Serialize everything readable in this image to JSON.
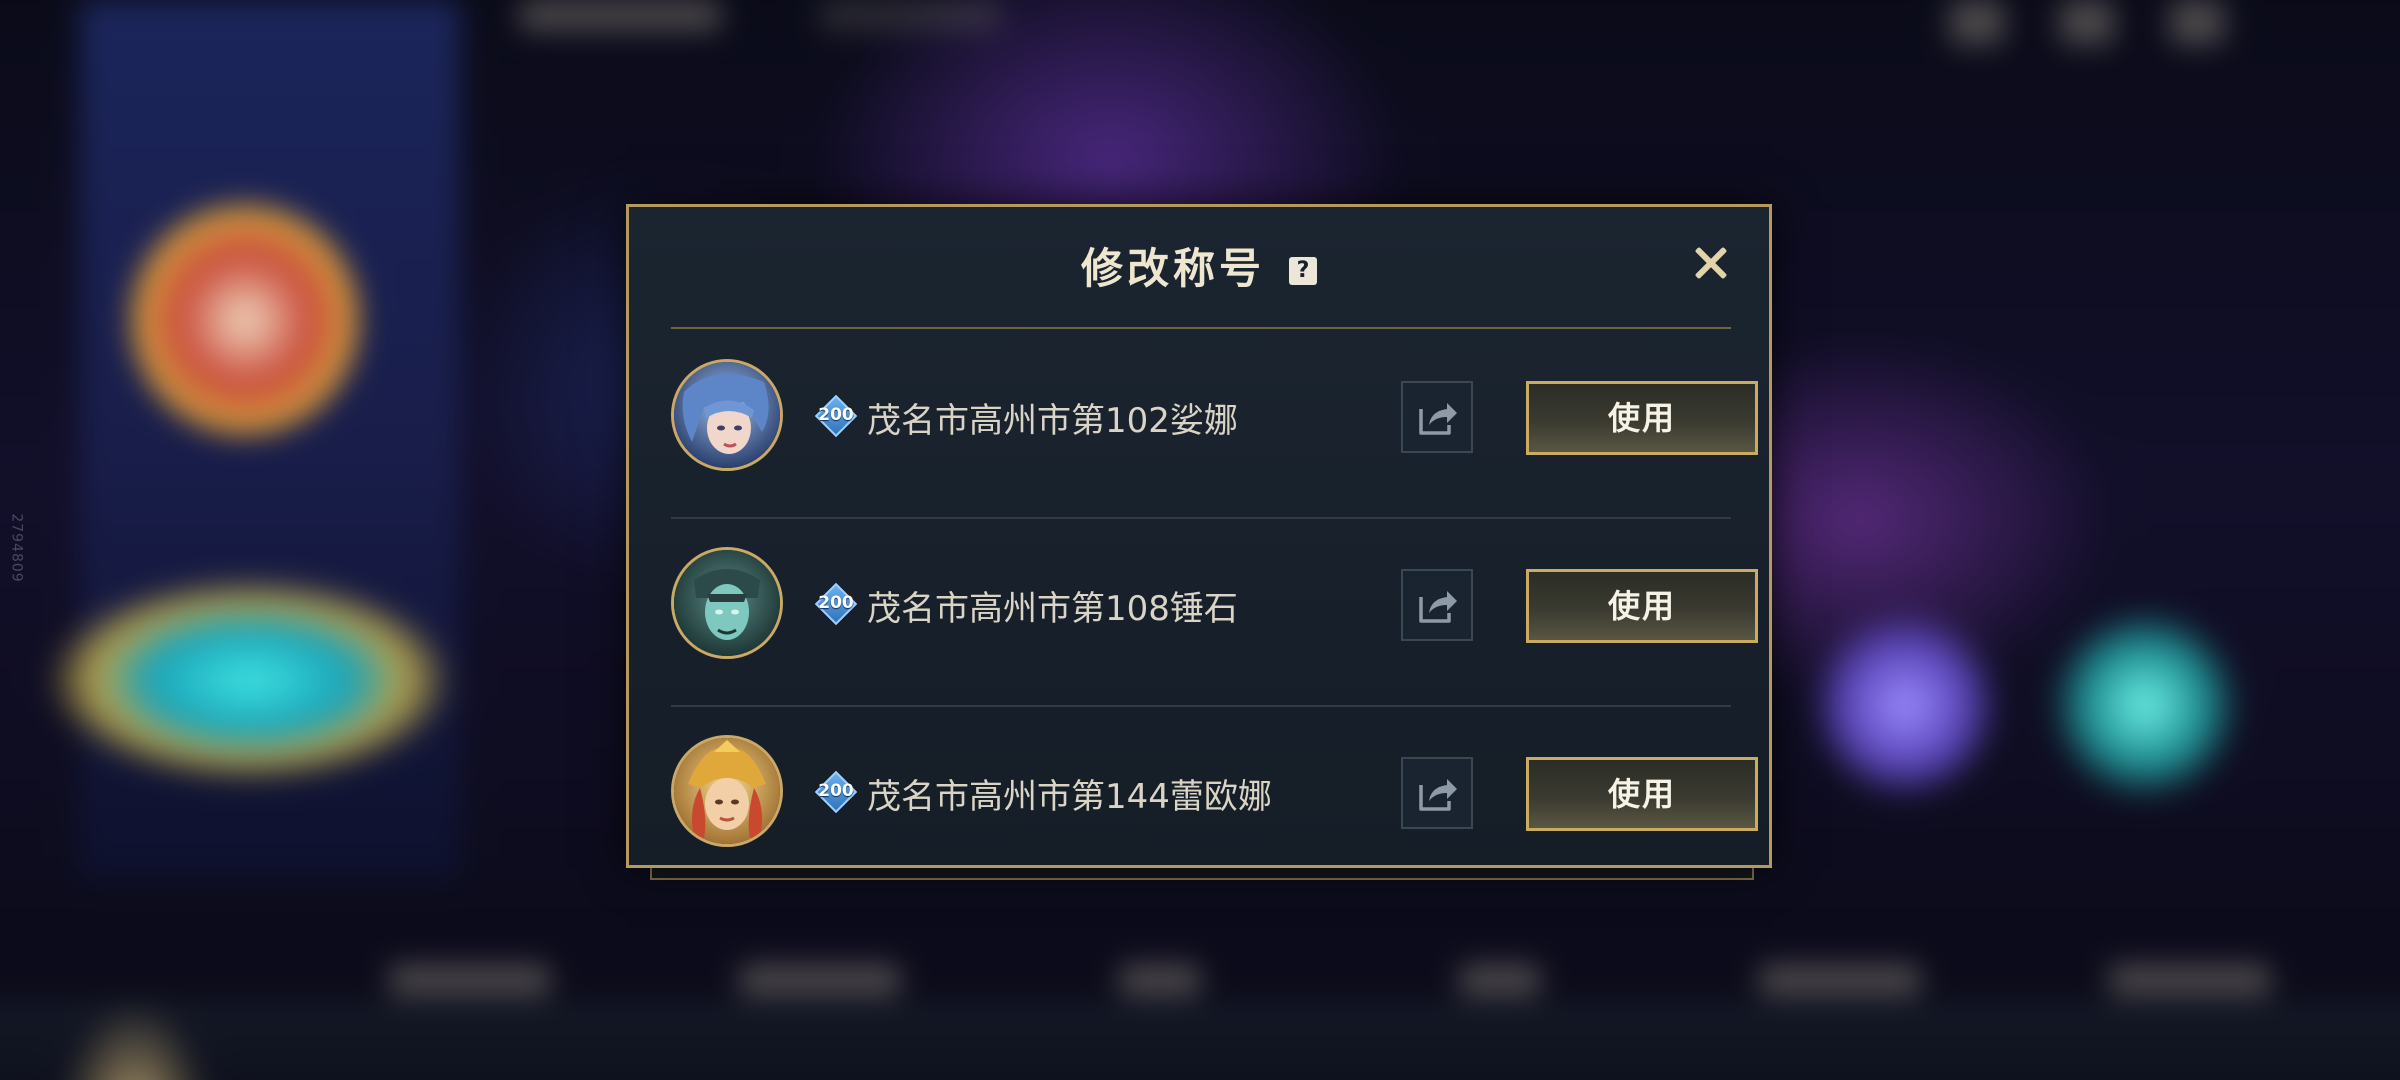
{
  "side_id": "2794809",
  "dialog": {
    "title": "修改称号",
    "help_glyph": "?",
    "use_label": "使用",
    "titles": [
      {
        "level": "200",
        "name": "茂名市高州市第102娑娜",
        "avatar_icon": "hero-portrait-blue-hair"
      },
      {
        "level": "200",
        "name": "茂名市高州市第108锤石",
        "avatar_icon": "hero-portrait-teal-skin"
      },
      {
        "level": "200",
        "name": "茂名市高州市第144蕾欧娜",
        "avatar_icon": "hero-portrait-golden-helmet"
      }
    ]
  },
  "colors": {
    "gold_border": "#b69a5c",
    "dialog_bg": "#18212b",
    "badge_blue": "#2d6fb8"
  }
}
